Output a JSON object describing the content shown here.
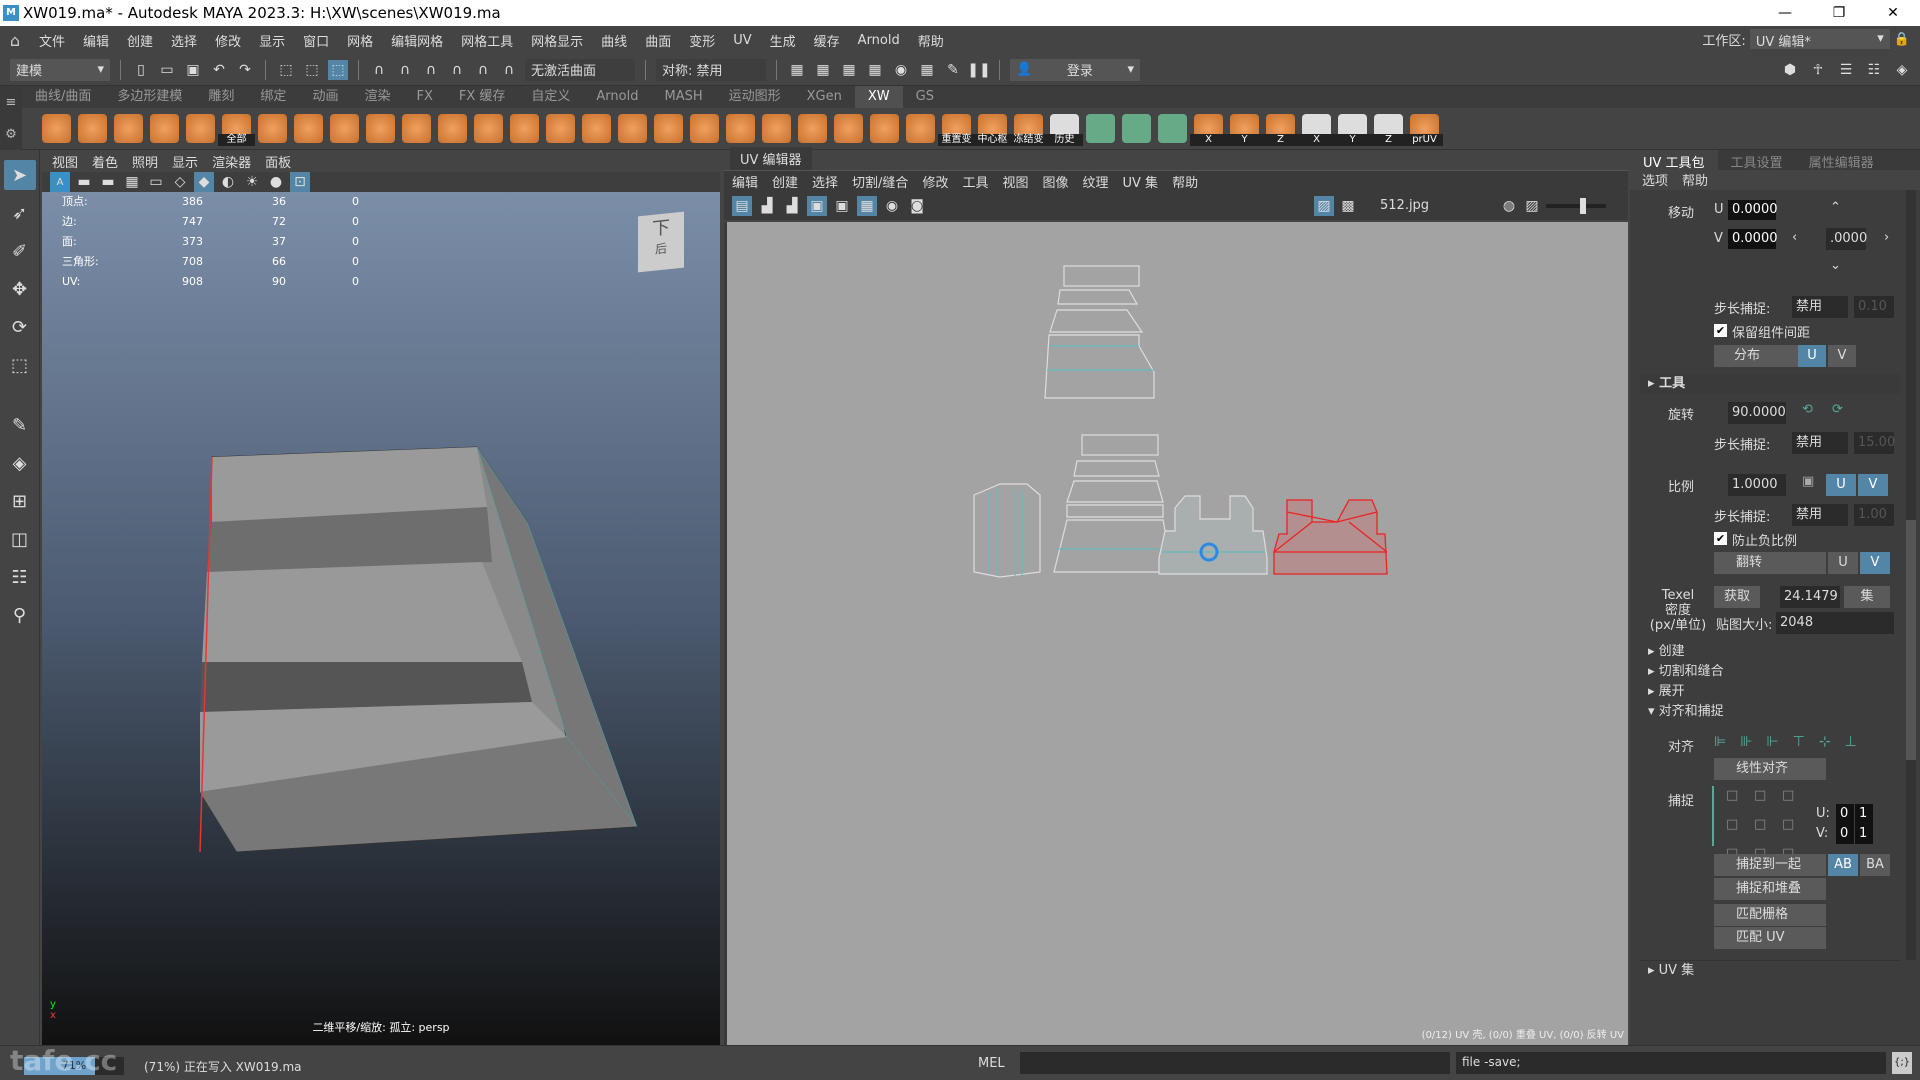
{
  "window": {
    "title": "XW019.ma* - Autodesk MAYA 2023.3: H:\\XW\\scenes\\XW019.ma",
    "minimize": "—",
    "maximize": "❐",
    "close": "✕"
  },
  "menubar": {
    "items": [
      "文件",
      "编辑",
      "创建",
      "选择",
      "修改",
      "显示",
      "窗口",
      "网格",
      "编辑网格",
      "网格工具",
      "网格显示",
      "曲线",
      "曲面",
      "变形",
      "UV",
      "生成",
      "缓存",
      "Arnold",
      "帮助"
    ],
    "workspace_label": "工作区:",
    "workspace_value": "UV 编辑*"
  },
  "statusline": {
    "mode": "建模",
    "live_surface": "无激活曲面",
    "symmetry": "对称: 禁用",
    "login": "登录"
  },
  "shelf": {
    "tabs": [
      "曲线/曲面",
      "多边形建模",
      "雕刻",
      "绑定",
      "动画",
      "渲染",
      "FX",
      "FX 缓存",
      "自定义",
      "Arnold",
      "MASH",
      "运动图形",
      "XGen",
      "XW",
      "GS"
    ],
    "active_tab": "XW",
    "icons": [
      {
        "name": "sphere-icon",
        "label": ""
      },
      {
        "name": "cube-icon",
        "label": ""
      },
      {
        "name": "cylinder-icon",
        "label": ""
      },
      {
        "name": "wire-cube-icon",
        "label": ""
      },
      {
        "name": "uv-chain-icon",
        "label": ""
      },
      {
        "name": "select-all-icon",
        "label": "全部"
      },
      {
        "name": "layer-down-icon",
        "label": ""
      },
      {
        "name": "layer-up-icon",
        "label": ""
      },
      {
        "name": "scatter-icon",
        "label": ""
      },
      {
        "name": "grid-icon",
        "label": ""
      },
      {
        "name": "tile-icon",
        "label": ""
      },
      {
        "name": "frame-icon",
        "label": ""
      },
      {
        "name": "sparkle-cube-icon",
        "label": ""
      },
      {
        "name": "bevel-cube-icon",
        "label": ""
      },
      {
        "name": "extrude-icon",
        "label": ""
      },
      {
        "name": "stack-icon",
        "label": ""
      },
      {
        "name": "uv-path-icon",
        "label": ""
      },
      {
        "name": "unfold-icon",
        "label": ""
      },
      {
        "name": "cut-icon",
        "label": ""
      },
      {
        "name": "split-grid-icon",
        "label": ""
      },
      {
        "name": "knife-icon",
        "label": ""
      },
      {
        "name": "shell-icon",
        "label": ""
      },
      {
        "name": "shell2-icon",
        "label": ""
      },
      {
        "name": "plane-icon",
        "label": ""
      },
      {
        "name": "lock-icon",
        "label": ""
      },
      {
        "name": "axis-icon",
        "label": "重置变"
      },
      {
        "name": "axis-icon",
        "label": "中心枢"
      },
      {
        "name": "axis-icon",
        "label": "冻结变"
      },
      {
        "name": "edit-icon",
        "label": "历史"
      },
      {
        "name": "checker-icon",
        "label": ""
      },
      {
        "name": "checker-cube-icon",
        "label": ""
      },
      {
        "name": "ring-icon",
        "label": ""
      },
      {
        "name": "mirror-icon",
        "label": "X"
      },
      {
        "name": "mirror-icon",
        "label": "Y"
      },
      {
        "name": "mirror-icon",
        "label": "Z"
      },
      {
        "name": "edit-icon",
        "label": "X"
      },
      {
        "name": "edit-icon",
        "label": "Y"
      },
      {
        "name": "edit-icon",
        "label": "Z"
      },
      {
        "name": "pruv-icon",
        "label": "prUV"
      }
    ]
  },
  "viewport": {
    "menu": [
      "视图",
      "着色",
      "照明",
      "显示",
      "渲染器",
      "面板"
    ],
    "hud": [
      {
        "label": "顶点:",
        "a": "386",
        "b": "36",
        "c": "0"
      },
      {
        "label": "边:",
        "a": "747",
        "b": "72",
        "c": "0"
      },
      {
        "label": "面:",
        "a": "373",
        "b": "37",
        "c": "0"
      },
      {
        "label": "三角形:",
        "a": "708",
        "b": "66",
        "c": "0"
      },
      {
        "label": "UV:",
        "a": "908",
        "b": "90",
        "c": "0"
      }
    ],
    "viewcube_top": "下",
    "viewcube_front": "后",
    "caption": "二维平移/缩放: 孤立: persp"
  },
  "uv_editor": {
    "title": "UV 编辑器",
    "menu": [
      "编辑",
      "创建",
      "选择",
      "切割/缝合",
      "修改",
      "工具",
      "视图",
      "图像",
      "纹理",
      "UV 集",
      "帮助"
    ],
    "image_name": "512.jpg",
    "status": "(0/12) UV 壳, (0/0) 重叠 UV, (0/0) 反转 UV"
  },
  "right_panel": {
    "tabs": [
      "UV 工具包",
      "工具设置",
      "属性编辑器"
    ],
    "active_tab": "UV 工具包",
    "submenu": [
      "选项",
      "帮助"
    ],
    "move": {
      "label": "移动",
      "u_label": "U",
      "u": "0.0000",
      "v_label": "V",
      "v": "0.0000",
      "step": ".0000"
    },
    "step_snap": "步长捕捉:",
    "disabled": "禁用",
    "move_snap_value": "0.10",
    "preserve_spacing": {
      "label": "保留组件间距",
      "checked": true
    },
    "distribute": {
      "label": "分布",
      "u": "U",
      "v": "V"
    },
    "tools_section": "工具",
    "rotate": {
      "label": "旋转",
      "value": "90.0000",
      "snap_value": "15.00"
    },
    "scale": {
      "label": "比例",
      "value": "1.0000",
      "u": "U",
      "v": "V",
      "snap_value": "1.00"
    },
    "prevent_negative": {
      "label": "防止负比例",
      "checked": true
    },
    "flip": {
      "label": "翻转",
      "u": "U",
      "v": "V"
    },
    "texel": {
      "label1": "Texel",
      "label2": "密度",
      "label3": "(px/单位)",
      "get": "获取",
      "value": "24.1479",
      "set": "集",
      "map_size_label": "贴图大小:",
      "map_size": "2048"
    },
    "sections": [
      "创建",
      "切割和缝合",
      "展开",
      "对齐和捕捉"
    ],
    "align": {
      "label": "对齐",
      "linear": "线性对齐"
    },
    "snap": {
      "label": "捕捉",
      "u_label": "U:",
      "v_label": "V:",
      "u0": "0",
      "u1": "1",
      "v0": "0",
      "v1": "1"
    },
    "snap_together": "捕捉到一起",
    "ab": "AB",
    "ba": "BA",
    "snap_stack": "捕捉和堆叠",
    "match_grid": "匹配栅格",
    "match_uv": "匹配 UV",
    "uv_sets": "UV 集"
  },
  "bottom": {
    "progress_percent": 71,
    "progress_label": "71%",
    "progress_message": "(71%) 正在写入 XW019.ma",
    "mel_label": "MEL",
    "mel_input": "",
    "result": "file -save;",
    "watermark": "tafe.cc"
  }
}
